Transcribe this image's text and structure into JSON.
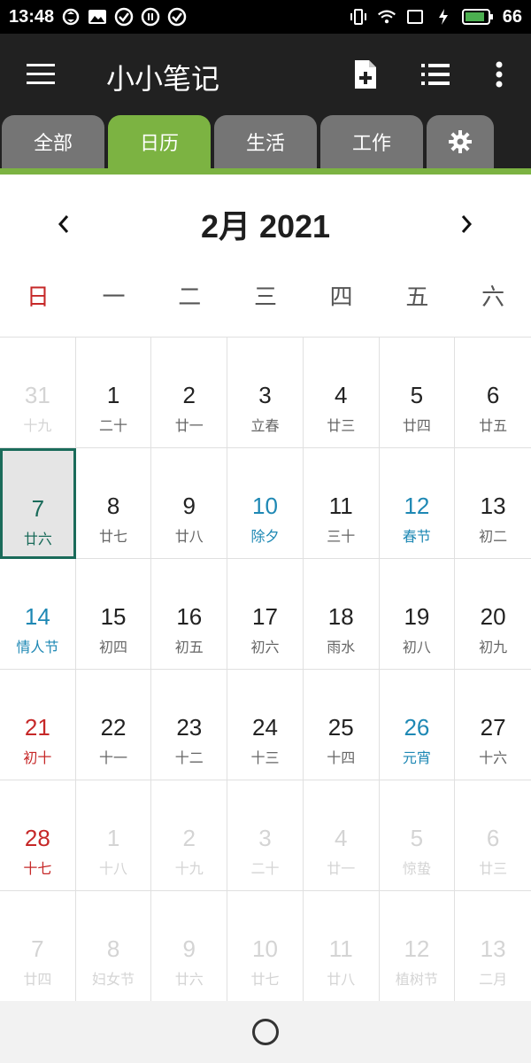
{
  "status_bar": {
    "time": "13:48",
    "battery": "66"
  },
  "app_bar": {
    "title": "小小笔记"
  },
  "tabs": [
    {
      "label": "全部",
      "active": false
    },
    {
      "label": "日历",
      "active": true
    },
    {
      "label": "生活",
      "active": false
    },
    {
      "label": "工作",
      "active": false
    }
  ],
  "calendar": {
    "month_title": "2月 2021",
    "weekdays": [
      "日",
      "一",
      "二",
      "三",
      "四",
      "五",
      "六"
    ],
    "weeks": [
      [
        {
          "day": "31",
          "lunar": "十九",
          "type": "other"
        },
        {
          "day": "1",
          "lunar": "二十",
          "type": "normal"
        },
        {
          "day": "2",
          "lunar": "廿一",
          "type": "normal"
        },
        {
          "day": "3",
          "lunar": "立春",
          "type": "normal"
        },
        {
          "day": "4",
          "lunar": "廿三",
          "type": "normal"
        },
        {
          "day": "5",
          "lunar": "廿四",
          "type": "normal"
        },
        {
          "day": "6",
          "lunar": "廿五",
          "type": "normal"
        }
      ],
      [
        {
          "day": "7",
          "lunar": "廿六",
          "type": "today"
        },
        {
          "day": "8",
          "lunar": "廿七",
          "type": "normal"
        },
        {
          "day": "9",
          "lunar": "廿八",
          "type": "normal"
        },
        {
          "day": "10",
          "lunar": "除夕",
          "type": "holiday"
        },
        {
          "day": "11",
          "lunar": "三十",
          "type": "normal"
        },
        {
          "day": "12",
          "lunar": "春节",
          "type": "holiday"
        },
        {
          "day": "13",
          "lunar": "初二",
          "type": "normal"
        }
      ],
      [
        {
          "day": "14",
          "lunar": "情人节",
          "type": "holiday"
        },
        {
          "day": "15",
          "lunar": "初四",
          "type": "normal"
        },
        {
          "day": "16",
          "lunar": "初五",
          "type": "normal"
        },
        {
          "day": "17",
          "lunar": "初六",
          "type": "normal"
        },
        {
          "day": "18",
          "lunar": "雨水",
          "type": "normal"
        },
        {
          "day": "19",
          "lunar": "初八",
          "type": "normal"
        },
        {
          "day": "20",
          "lunar": "初九",
          "type": "normal"
        }
      ],
      [
        {
          "day": "21",
          "lunar": "初十",
          "type": "sunday"
        },
        {
          "day": "22",
          "lunar": "十一",
          "type": "normal"
        },
        {
          "day": "23",
          "lunar": "十二",
          "type": "normal"
        },
        {
          "day": "24",
          "lunar": "十三",
          "type": "normal"
        },
        {
          "day": "25",
          "lunar": "十四",
          "type": "normal"
        },
        {
          "day": "26",
          "lunar": "元宵",
          "type": "holiday"
        },
        {
          "day": "27",
          "lunar": "十六",
          "type": "normal"
        }
      ],
      [
        {
          "day": "28",
          "lunar": "十七",
          "type": "sunday"
        },
        {
          "day": "1",
          "lunar": "十八",
          "type": "other"
        },
        {
          "day": "2",
          "lunar": "十九",
          "type": "other"
        },
        {
          "day": "3",
          "lunar": "二十",
          "type": "other"
        },
        {
          "day": "4",
          "lunar": "廿一",
          "type": "other"
        },
        {
          "day": "5",
          "lunar": "惊蛰",
          "type": "other"
        },
        {
          "day": "6",
          "lunar": "廿三",
          "type": "other"
        }
      ],
      [
        {
          "day": "7",
          "lunar": "廿四",
          "type": "other"
        },
        {
          "day": "8",
          "lunar": "妇女节",
          "type": "other"
        },
        {
          "day": "9",
          "lunar": "廿六",
          "type": "other"
        },
        {
          "day": "10",
          "lunar": "廿七",
          "type": "other"
        },
        {
          "day": "11",
          "lunar": "廿八",
          "type": "other"
        },
        {
          "day": "12",
          "lunar": "植树节",
          "type": "other"
        },
        {
          "day": "13",
          "lunar": "二月",
          "type": "other"
        }
      ]
    ]
  },
  "colors": {
    "accent_green": "#7cb342",
    "app_bar_bg": "#212121",
    "tab_inactive": "#757575",
    "sunday_red": "#c62828",
    "holiday_blue": "#1e88b4",
    "today_border": "#1a6b5a"
  }
}
